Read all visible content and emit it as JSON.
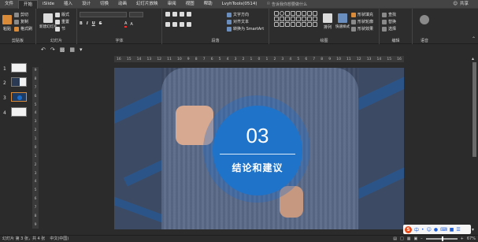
{
  "menubar": {
    "tabs": [
      "文件",
      "开始",
      "iSlide",
      "插入",
      "设计",
      "切换",
      "动画",
      "幻灯片放映",
      "审阅",
      "视图",
      "帮助",
      "LvyhTools(0514)"
    ],
    "active_tab": "开始",
    "tellme_placeholder": "告诉我你想要做什么",
    "share_label": "共享"
  },
  "ribbon": {
    "clipboard": {
      "label": "剪贴板",
      "cut": "剪切",
      "copy": "复制",
      "format_painter": "格式刷",
      "paste": "粘贴"
    },
    "slides": {
      "label": "幻灯片",
      "new_slide": "新建幻灯片",
      "layout": "版式",
      "reset": "重置",
      "section": "节"
    },
    "font": {
      "label": "字体"
    },
    "paragraph": {
      "label": "段落",
      "text_direction": "文字方向",
      "align_text": "对齐文本",
      "smartart": "转换为 SmartArt"
    },
    "drawing": {
      "label": "绘图",
      "arrange": "排列",
      "quick_styles": "快速样式",
      "shape_fill": "形状填充",
      "shape_outline": "形状轮廓",
      "shape_effects": "形状效果"
    },
    "editing": {
      "label": "编辑",
      "find": "查找",
      "replace": "替换",
      "select": "选择"
    },
    "voice": {
      "label": "语音"
    }
  },
  "thumbnails": [
    {
      "number": "1"
    },
    {
      "number": "2"
    },
    {
      "number": "3"
    },
    {
      "number": "4"
    }
  ],
  "rulers": {
    "horizontal": [
      "16",
      "15",
      "14",
      "13",
      "12",
      "11",
      "10",
      "9",
      "8",
      "7",
      "6",
      "5",
      "4",
      "3",
      "2",
      "1",
      "0",
      "1",
      "2",
      "3",
      "4",
      "5",
      "6",
      "7",
      "8",
      "9",
      "10",
      "11",
      "12",
      "13",
      "14",
      "15",
      "16"
    ],
    "vertical": [
      "9",
      "8",
      "7",
      "6",
      "5",
      "4",
      "3",
      "2",
      "1",
      "0",
      "1",
      "2",
      "3",
      "4",
      "5",
      "6",
      "7",
      "8",
      "9"
    ]
  },
  "slide": {
    "section_number": "03",
    "section_title": "结论和建议",
    "circle_color": "#1f73c9"
  },
  "statusbar": {
    "slide_info": "幻灯片 第 3 张，共 4 张",
    "language": "中文(中国)",
    "zoom": "67%"
  },
  "ime": {
    "logo": "S",
    "mode": "中"
  }
}
